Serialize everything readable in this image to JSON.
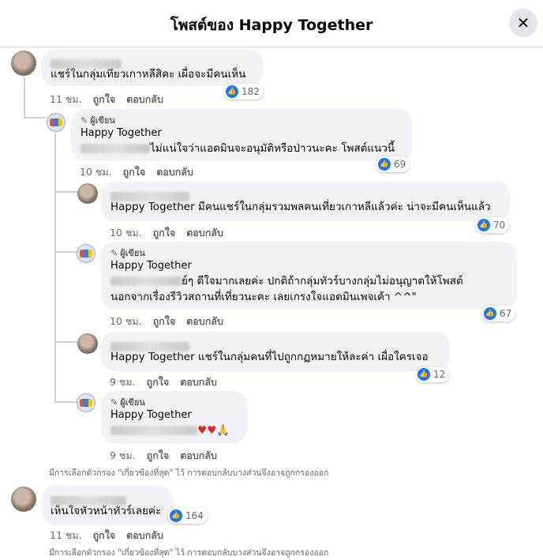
{
  "header": {
    "title": "โพสต์ของ Happy Together",
    "close_glyph": "✕"
  },
  "actions": {
    "like": "ถูกใจ",
    "reply": "ตอบกลับ"
  },
  "author_badge": "ผู้เขียน",
  "page_name": "Happy Together",
  "filter_note": "มีการเลือกตัวกรอง \"เกี่ยวข้องที่สุด\" ไว้ การตอบกลับบางส่วนจึงอาจถูกกรองออก",
  "comments": [
    {
      "text": "แชร์ในกลุ่มเที่ยวเกาหลีสิคะ เผื่อจะมีคนเห็น",
      "time": "11 ชม.",
      "likes": "182"
    },
    {
      "text": "ไม่แน่ใจว่าแอดมินจะอนุมัติหรือป่าวนะคะ โพสต์แนวนี้",
      "time": "10 ชม.",
      "likes": "69"
    },
    {
      "text": "Happy Together มีคนแชร์ในกลุ่มรวมพลคนเที่ยวเกาหลีแล้วค่ะ น่าจะมีคนเห็นแล้ว",
      "time": "10 ชม.",
      "likes": "70"
    },
    {
      "text_line1": "ย์ๆ ดีใจมากเลยค่ะ ปกติถ้ากลุ่มทัวร์บางกลุ่มไม่อนุญาตให้โพสต์",
      "text_line2": "นอกจากเรื่องรีวิวสถานที่เที่ยวนะคะ เลยเกรงใจแอดมินเพจเค้า ^^\"",
      "time": "10 ชม.",
      "likes": "67"
    },
    {
      "text": "Happy Together แชร์ในกลุ่มคนที่ไปถูกกฏหมายให้ละค่า เผื่อใครเจอ",
      "time": "9 ชม.",
      "likes": "12"
    },
    {
      "text": "♥♥🙏",
      "time": "9 ชม."
    },
    {
      "text": "เห็นใจหัวหน้าทัวร์เลยค่ะ",
      "time": "11 ชม.",
      "likes": "164"
    }
  ]
}
